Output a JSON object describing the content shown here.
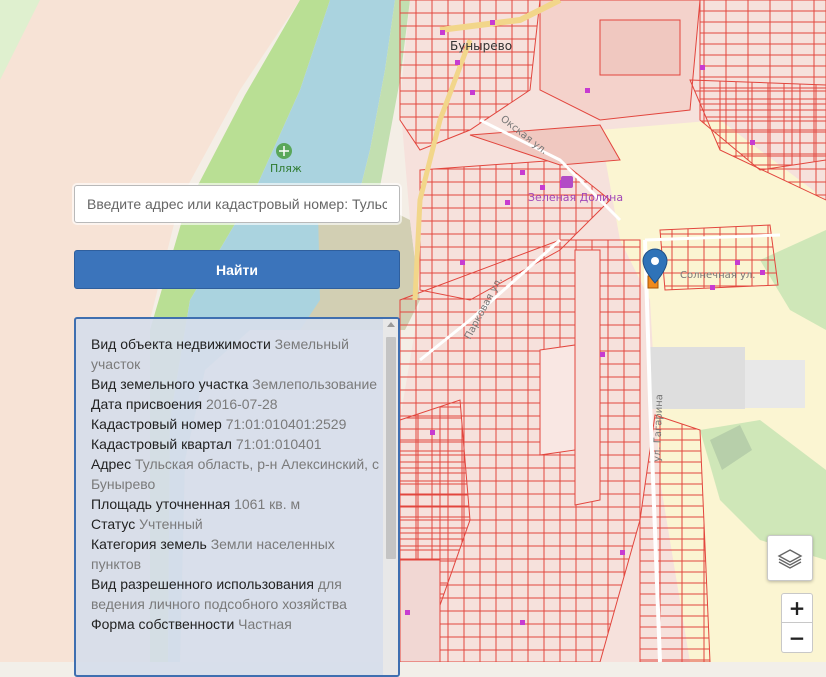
{
  "map": {
    "places": {
      "village": "Бунырево",
      "beach": "Пляж",
      "district": "Зеленая Долина"
    },
    "streets": {
      "oksky": "Окская ул.",
      "park": "Парковая ул.",
      "gagarina": "ул. Гагарина",
      "solnechnaya": "Солнечная ул."
    },
    "colors": {
      "river": "#aad3df",
      "green": "#c9e6b2",
      "parcel_outline": "#e2463e",
      "pin": "#2f73b8",
      "selected_parcel": "#f08a1c"
    }
  },
  "search": {
    "placeholder": "Введите адрес или кадастровый номер: Тульс",
    "value": "",
    "button_label": "Найти"
  },
  "info": {
    "rows": [
      {
        "label": "Вид объекта недвижимости",
        "value": "Земельный участок"
      },
      {
        "label": "Вид земельного участка",
        "value": "Землепользование"
      },
      {
        "label": "Дата присвоения",
        "value": "2016-07-28"
      },
      {
        "label": "Кадастровый номер",
        "value": "71:01:010401:2529"
      },
      {
        "label": "Кадастровый квартал",
        "value": "71:01:010401"
      },
      {
        "label": "Адрес",
        "value": "Тульская область, р-н Алексинский, с Бунырево"
      },
      {
        "label": "Площадь уточненная",
        "value": "1061 кв. м"
      },
      {
        "label": "Статус",
        "value": "Учтенный"
      },
      {
        "label": "Категория земель",
        "value": "Земли населенных пунктов"
      },
      {
        "label": "Вид разрешенного использования",
        "value": "для ведения личного подсобного хозяйства"
      },
      {
        "label": "Форма собственности",
        "value": "Частная"
      }
    ]
  },
  "controls": {
    "layers_icon": "layers-icon",
    "zoom_in": "+",
    "zoom_out": "−"
  }
}
